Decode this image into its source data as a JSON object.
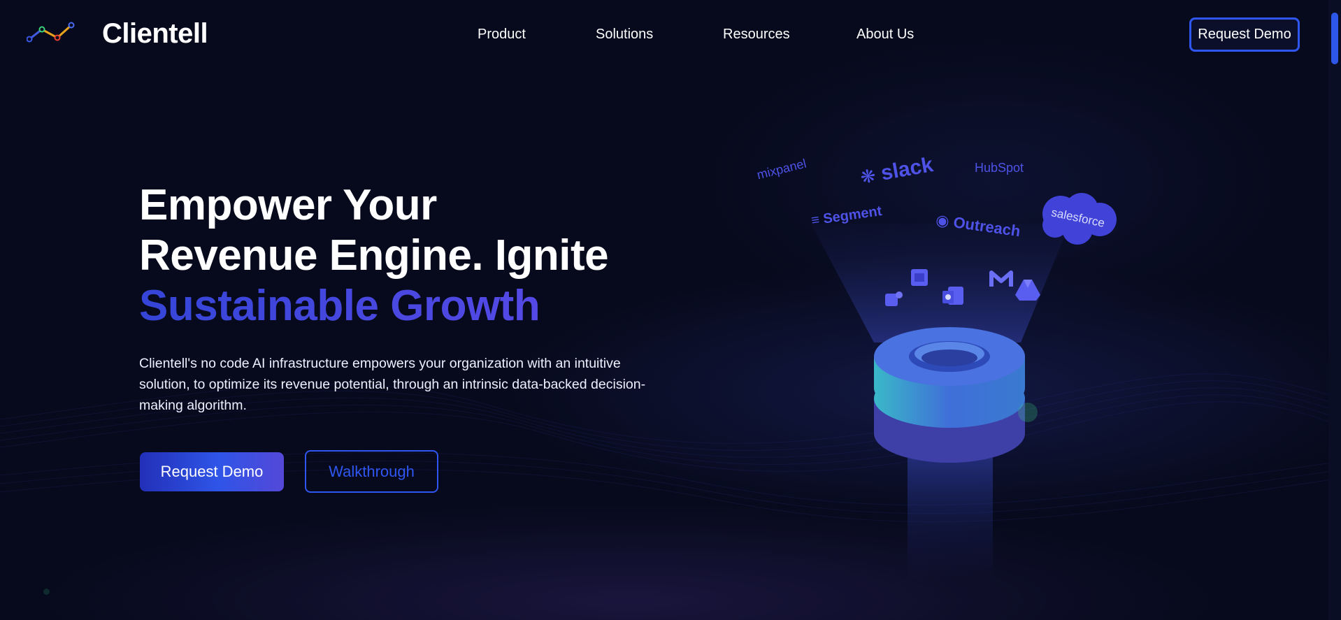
{
  "header": {
    "brand": "Clientell",
    "nav": [
      {
        "label": "Product"
      },
      {
        "label": "Solutions"
      },
      {
        "label": "Resources"
      },
      {
        "label": "About Us"
      }
    ],
    "cta_label": "Request Demo"
  },
  "hero": {
    "headline_line1": "Empower Your",
    "headline_line2": "Revenue Engine. Ignite",
    "headline_accent": "Sustainable Growth",
    "description": "Clientell's no code AI infrastructure empowers your organization with an intuitive solution, to optimize its revenue potential, through an intrinsic data-backed decision-making algorithm.",
    "primary_button": "Request Demo",
    "secondary_button": "Walkthrough"
  },
  "integrations": {
    "logos": [
      "mixpanel",
      "slack",
      "HubSpot",
      "Segment",
      "Outreach",
      "salesforce"
    ],
    "app_icons": [
      "teams-icon",
      "calendar-icon",
      "outlook-icon",
      "gmail-icon",
      "drive-icon"
    ]
  },
  "colors": {
    "background": "#070a1c",
    "accent": "#2f56f0",
    "headline_accent": "#3f4be0",
    "logo_tint": "#4e52e6"
  }
}
